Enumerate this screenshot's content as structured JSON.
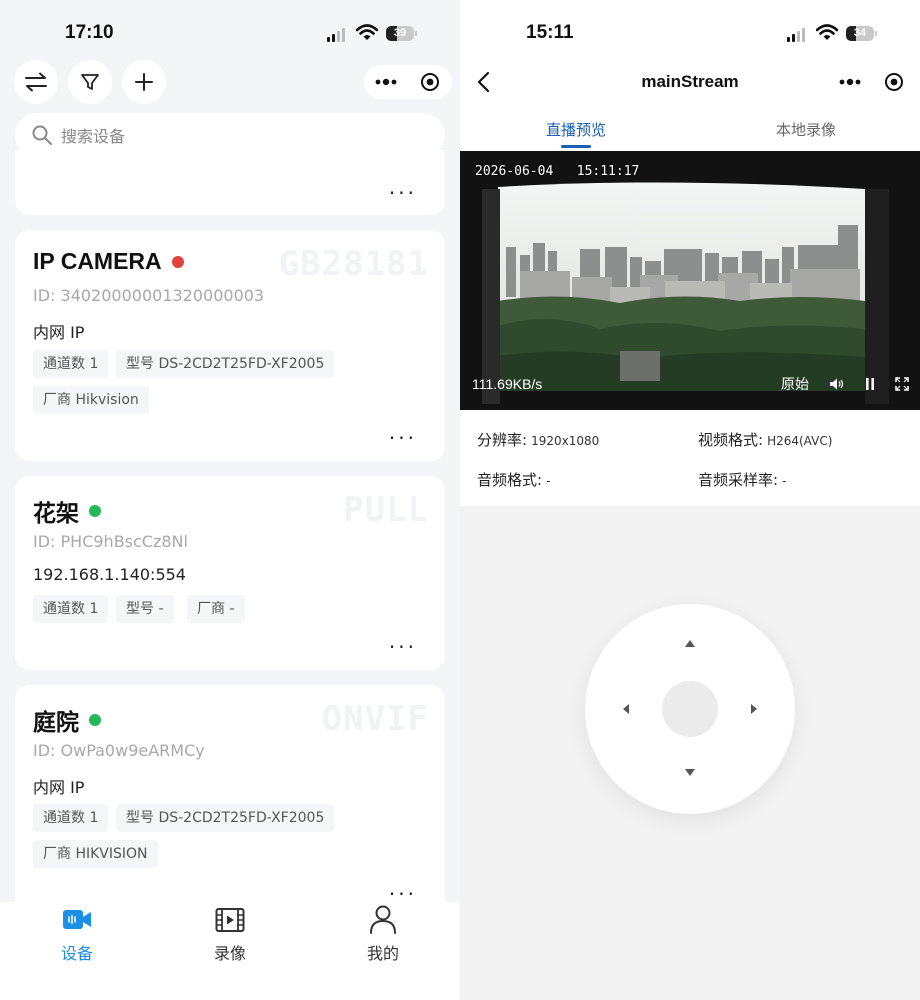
{
  "left_screen": {
    "status_time": "17:10",
    "battery": "39",
    "search_placeholder": "搜索设备",
    "devices": [
      {
        "name": "IP CAMERA",
        "status_color": "#e5413f",
        "protocol": "GB28181",
        "id": "ID: 34020000001320000003",
        "address": "内网 IP",
        "tags": [
          "通道数 1",
          "型号 DS-2CD2T25FD-XF2005",
          "厂商 Hikvision"
        ]
      },
      {
        "name": "花架",
        "status_color": "#25b85a",
        "protocol": "PULL",
        "id": "ID: PHC9hBscCz8Nl",
        "address": "192.168.1.140:554",
        "tags": [
          "通道数 1",
          "型号 -",
          "厂商 -"
        ]
      },
      {
        "name": "庭院",
        "status_color": "#25b85a",
        "protocol": "ONVIF",
        "id": "ID: OwPa0w9eARMCy",
        "address": "内网 IP",
        "tags": [
          "通道数 1",
          "型号 DS-2CD2T25FD-XF2005",
          "厂商 HIKVISION"
        ]
      }
    ],
    "more_label": "···",
    "tabbar": [
      {
        "label": "设备",
        "icon": "video-camera-icon",
        "active": true
      },
      {
        "label": "录像",
        "icon": "film-icon",
        "active": false
      },
      {
        "label": "我的",
        "icon": "person-icon",
        "active": false
      }
    ],
    "accent_color": "#1a8fe3"
  },
  "right_screen": {
    "status_time": "15:11",
    "battery": "34",
    "title": "mainStream",
    "tabs": [
      {
        "label": "直播预览",
        "active": true
      },
      {
        "label": "本地录像",
        "active": false
      }
    ],
    "video": {
      "timestamp": "2026-06-04   15:11:17",
      "bitrate": "111.69KB/s",
      "quality": "原始"
    },
    "stream_info": [
      {
        "label": "分辨率:",
        "value": "1920x1080"
      },
      {
        "label": "视频格式:",
        "value": "H264(AVC)"
      },
      {
        "label": "音频格式:",
        "value": "-"
      },
      {
        "label": "音频采样率:",
        "value": "-"
      }
    ],
    "accent_color": "#1a5fb4"
  }
}
